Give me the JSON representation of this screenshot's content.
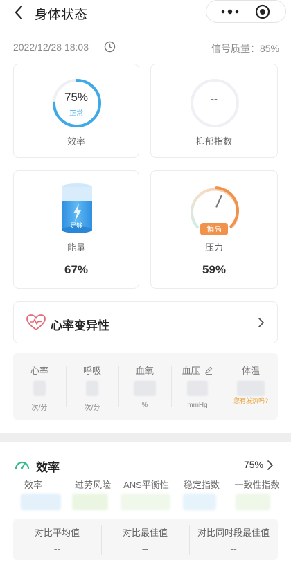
{
  "nav": {
    "title": "身体状态"
  },
  "meta": {
    "datetime": "2022/12/28 18:03",
    "signal": "信号质量：85%"
  },
  "cards": {
    "efficiency": {
      "ring_value": "75%",
      "ring_status": "正常",
      "label": "效率",
      "level": 0.75,
      "color": "#3fa9e8"
    },
    "depression": {
      "ring_value": "--",
      "label": "抑郁指数"
    },
    "energy": {
      "badge": "足够",
      "label": "能量",
      "value": "67%",
      "level": 0.67,
      "color": "#2f9be6"
    },
    "pressure": {
      "badge": "偏高",
      "label": "压力",
      "value": "59%",
      "level": 0.59,
      "color": "#f0924a"
    }
  },
  "hrv": {
    "label": "心率变异性"
  },
  "vitals": [
    {
      "name": "心率",
      "unit": "次/分"
    },
    {
      "name": "呼吸",
      "unit": "次/分"
    },
    {
      "name": "血氧",
      "unit": "%"
    },
    {
      "name": "血压",
      "unit": "mmHg"
    },
    {
      "name": "体温",
      "unit": "您有发热吗?"
    }
  ],
  "efficiency_section": {
    "title": "效率",
    "percent": "75%",
    "metrics": [
      "效率",
      "过劳风险",
      "ANS平衡性",
      "稳定指数",
      "一致性指数"
    ],
    "compare": [
      {
        "label": "对比平均值",
        "value": "--"
      },
      {
        "label": "对比最佳值",
        "value": "--"
      },
      {
        "label": "对比同时段最佳值",
        "value": "--"
      }
    ]
  }
}
